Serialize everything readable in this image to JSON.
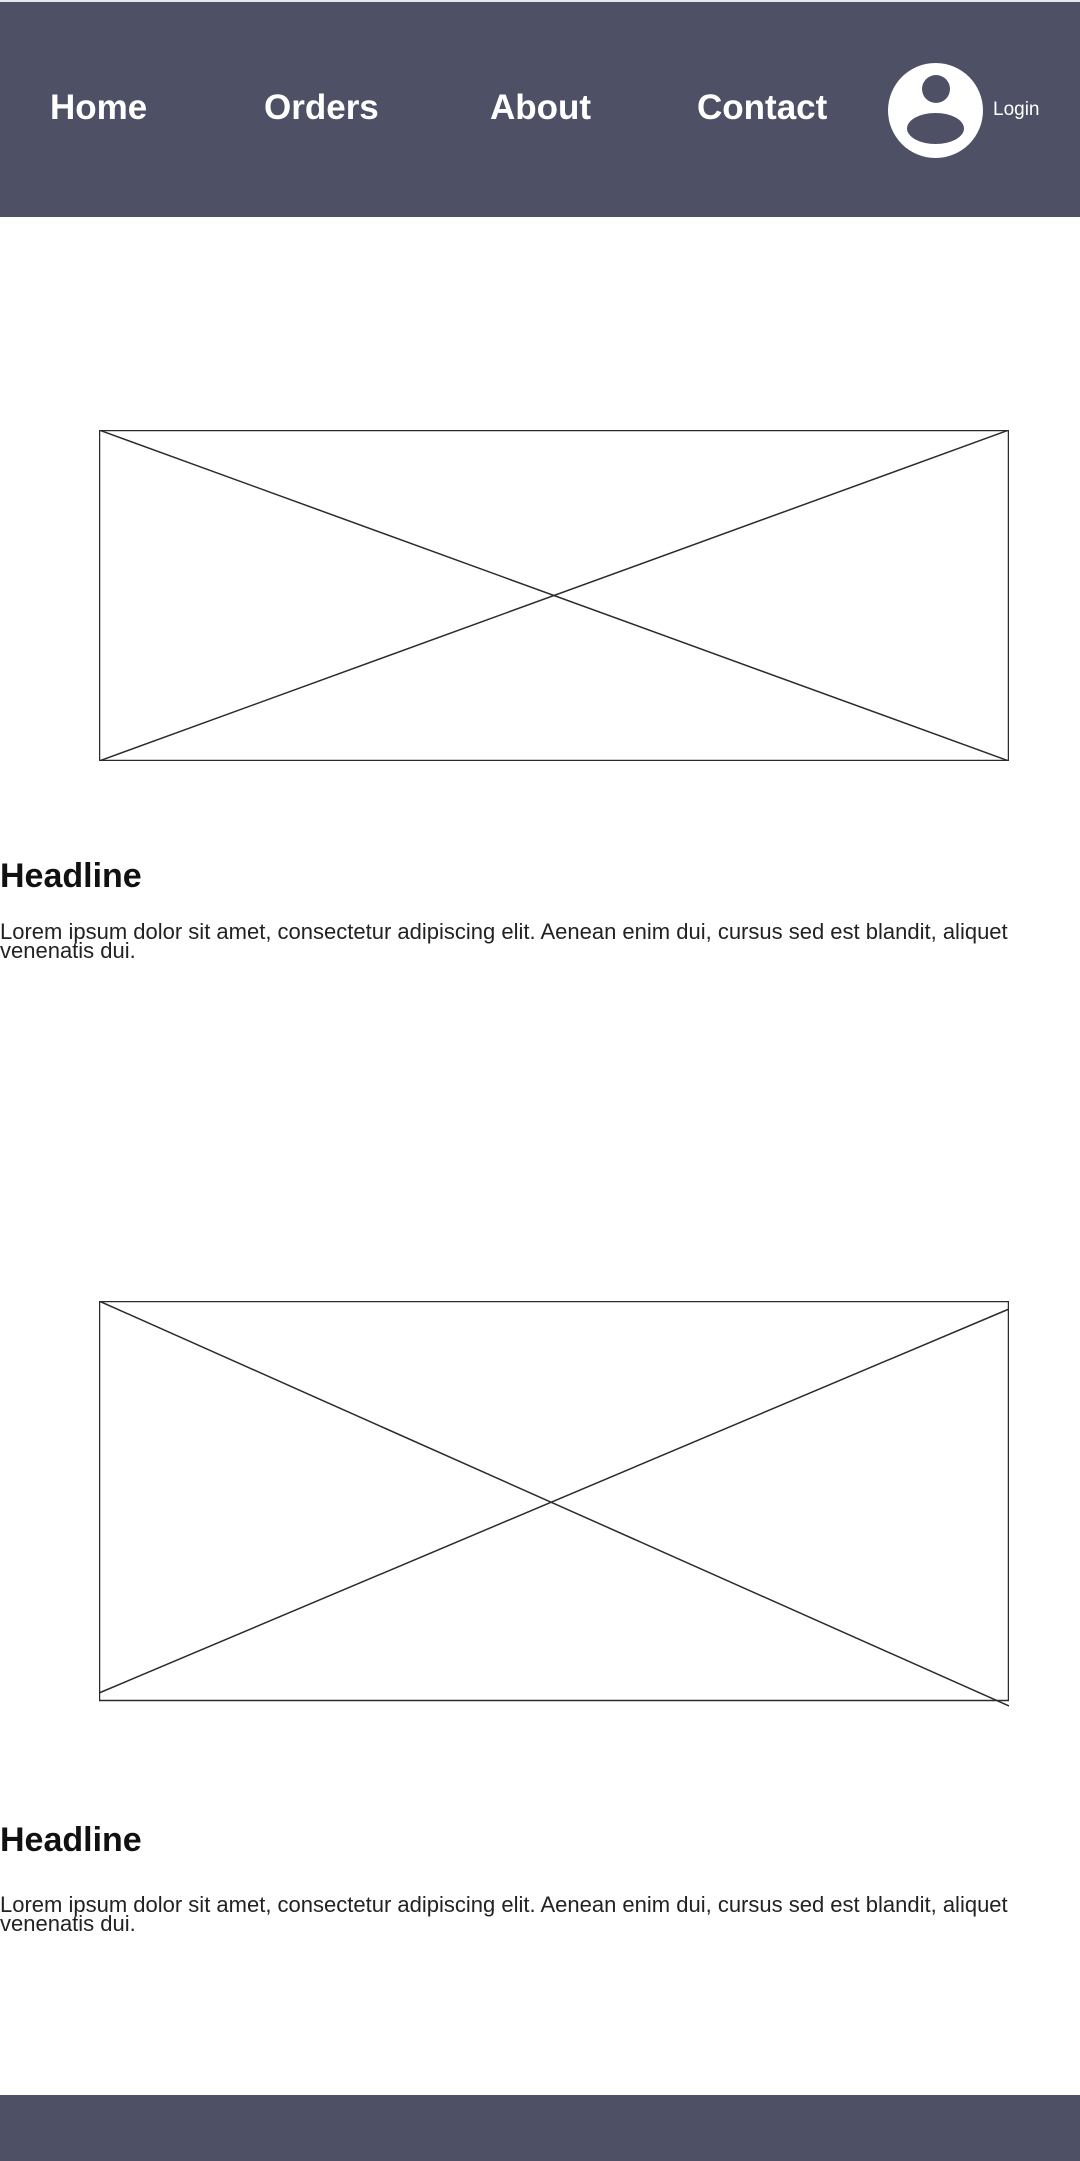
{
  "colors": {
    "bar": "#4e5166",
    "avatar_bg": "#ffffff",
    "avatar_figure": "#4e5166",
    "placeholder_line": "#2b2b2b"
  },
  "header": {
    "nav": [
      {
        "label": "Home"
      },
      {
        "label": "Orders"
      },
      {
        "label": "About"
      },
      {
        "label": "Contact"
      }
    ],
    "avatar_icon": "user-avatar-icon",
    "login_label": "Login"
  },
  "sections": [
    {
      "image_icon": "image-placeholder-icon",
      "headline": "Headline",
      "body": "Lorem ipsum dolor sit amet, consectetur adipiscing elit. Aenean enim dui, cursus sed est blandit, aliquet venenatis dui."
    },
    {
      "image_icon": "image-placeholder-icon",
      "headline": "Headline",
      "body": "Lorem ipsum dolor sit amet, consectetur adipiscing elit. Aenean enim dui, cursus sed est blandit, aliquet venenatis dui."
    }
  ]
}
